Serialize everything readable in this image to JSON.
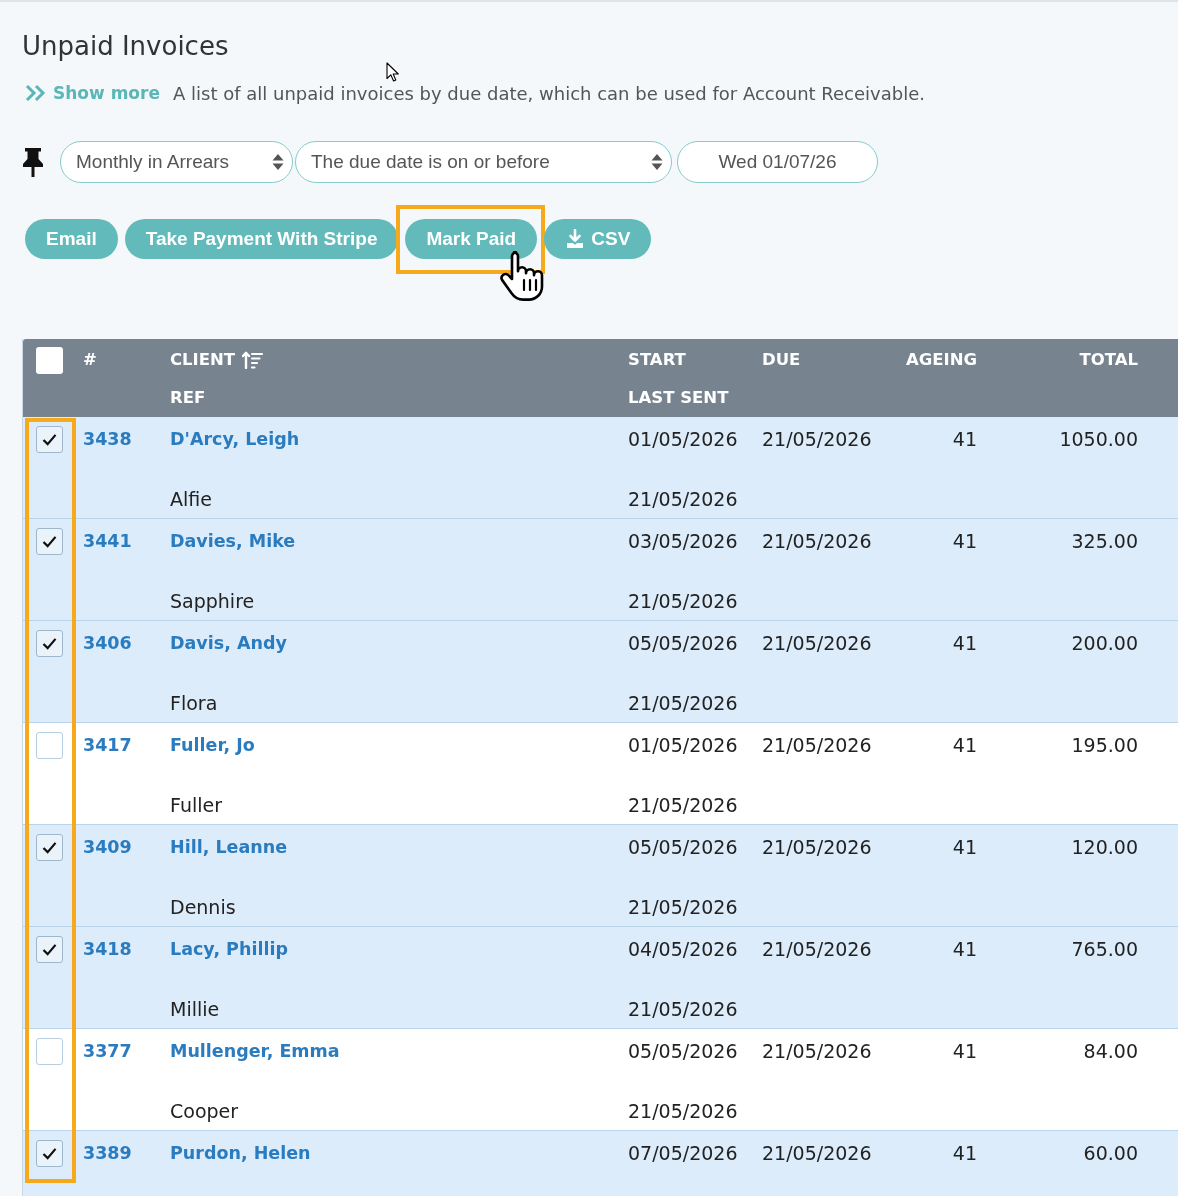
{
  "page": {
    "title": "Unpaid Invoices"
  },
  "intro": {
    "toggle": "Show more",
    "description": "A list of all unpaid invoices by due date, which can be used for Account Receivable."
  },
  "filters": [
    {
      "kind": "select",
      "value": "Monthly in Arrears"
    },
    {
      "kind": "select",
      "value": "The due date is on or before"
    },
    {
      "kind": "date",
      "value": "Wed 01/07/26"
    }
  ],
  "actions": [
    {
      "kind": "text",
      "label": "Email",
      "highlighted": false
    },
    {
      "kind": "text",
      "label": "Take Payment With Stripe",
      "highlighted": false
    },
    {
      "kind": "text",
      "label": "Mark Paid",
      "highlighted": true
    },
    {
      "kind": "download",
      "label": "CSV",
      "highlighted": false
    }
  ],
  "table": {
    "select_all": {
      "checked": false
    },
    "checkbox_column_highlighted": true,
    "columns": [
      {
        "label": "#",
        "sorted": false
      },
      {
        "label": "CLIENT",
        "sub_label": "REF",
        "sorted": true
      },
      {
        "label": "START",
        "sub_label": "LAST SENT",
        "sorted": false
      },
      {
        "label": "DUE",
        "sorted": false
      },
      {
        "label": "AGEING",
        "sorted": false
      },
      {
        "label": "TOTAL",
        "sorted": false
      }
    ],
    "rows": [
      {
        "selected": true,
        "number": "3438",
        "client": "D'Arcy, Leigh",
        "start": "01/05/2026",
        "due": "21/05/2026",
        "ageing": "41",
        "total": "1050.00",
        "ref": "Alfie",
        "last_sent": "21/05/2026"
      },
      {
        "selected": true,
        "number": "3441",
        "client": "Davies, Mike",
        "start": "03/05/2026",
        "due": "21/05/2026",
        "ageing": "41",
        "total": "325.00",
        "ref": "Sapphire",
        "last_sent": "21/05/2026"
      },
      {
        "selected": true,
        "number": "3406",
        "client": "Davis, Andy",
        "start": "05/05/2026",
        "due": "21/05/2026",
        "ageing": "41",
        "total": "200.00",
        "ref": "Flora",
        "last_sent": "21/05/2026"
      },
      {
        "selected": false,
        "number": "3417",
        "client": "Fuller, Jo",
        "start": "01/05/2026",
        "due": "21/05/2026",
        "ageing": "41",
        "total": "195.00",
        "ref": "Fuller",
        "last_sent": "21/05/2026"
      },
      {
        "selected": true,
        "number": "3409",
        "client": "Hill, Leanne",
        "start": "05/05/2026",
        "due": "21/05/2026",
        "ageing": "41",
        "total": "120.00",
        "ref": "Dennis",
        "last_sent": "21/05/2026"
      },
      {
        "selected": true,
        "number": "3418",
        "client": "Lacy, Phillip",
        "start": "04/05/2026",
        "due": "21/05/2026",
        "ageing": "41",
        "total": "765.00",
        "ref": "Millie",
        "last_sent": "21/05/2026"
      },
      {
        "selected": false,
        "number": "3377",
        "client": "Mullenger, Emma",
        "start": "05/05/2026",
        "due": "21/05/2026",
        "ageing": "41",
        "total": "84.00",
        "ref": "Cooper",
        "last_sent": "21/05/2026"
      },
      {
        "selected": true,
        "number": "3389",
        "client": "Purdon, Helen",
        "start": "07/05/2026",
        "due": "21/05/2026",
        "ageing": "41",
        "total": "60.00"
      }
    ]
  }
}
